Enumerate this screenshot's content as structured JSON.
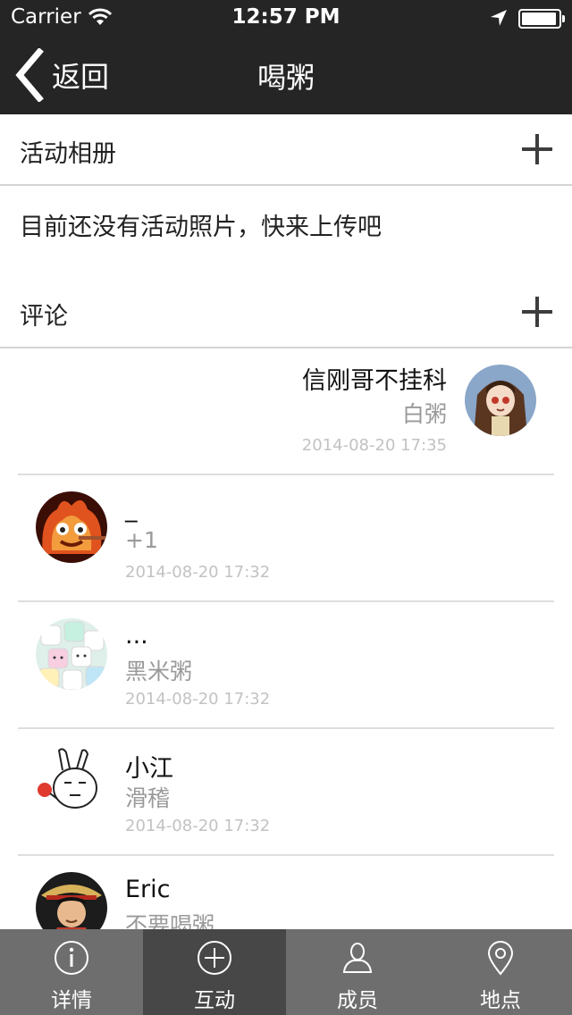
{
  "status_bar": {
    "carrier": "Carrier",
    "time": "12:57 PM",
    "battery_level": 0.95
  },
  "nav": {
    "back_label": "返回",
    "title": "喝粥"
  },
  "album": {
    "title": "活动相册",
    "empty_text": "目前还没有活动照片，快来上传吧"
  },
  "comments_section": {
    "title": "评论"
  },
  "comments": [
    {
      "name": "信刚哥不挂科",
      "text": "白粥",
      "time": "2014-08-20 17:35",
      "align": "right"
    },
    {
      "name": "_",
      "text": "+1",
      "time": "2014-08-20 17:32",
      "align": "left"
    },
    {
      "name": "...",
      "text": "黑米粥",
      "time": "2014-08-20 17:32",
      "align": "left"
    },
    {
      "name": "小江",
      "text": "滑稽",
      "time": "2014-08-20 17:32",
      "align": "left"
    },
    {
      "name": "Eric",
      "text": "不要喝粥",
      "time": "",
      "align": "left"
    }
  ],
  "tabs": [
    {
      "label": "详情",
      "icon": "info-icon",
      "active": false
    },
    {
      "label": "互动",
      "icon": "plus-circle-icon",
      "active": true
    },
    {
      "label": "成员",
      "icon": "person-icon",
      "active": false
    },
    {
      "label": "地点",
      "icon": "location-pin-icon",
      "active": false
    }
  ]
}
